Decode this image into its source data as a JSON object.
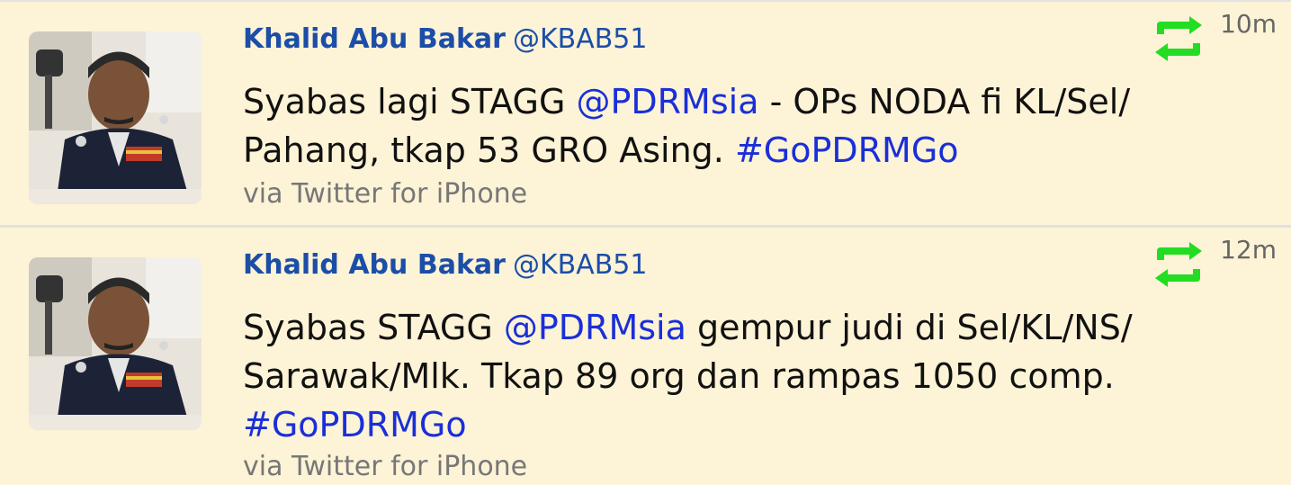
{
  "tweets": [
    {
      "name": "Khalid Abu Bakar",
      "handle": "@KBAB51",
      "time": "10m",
      "text_parts": [
        {
          "text": "Syabas lagi STAGG ",
          "kind": "plain"
        },
        {
          "text": "@PDRMsia",
          "kind": "mention"
        },
        {
          "text": " - OPs NODA fi KL/Sel/ Pahang, tkap 53 GRO Asing. ",
          "kind": "plain"
        },
        {
          "text": "#GoPDRMGo",
          "kind": "hashtag"
        }
      ],
      "via": "via Twitter for iPhone",
      "avatar_icon": "avatar-photo"
    },
    {
      "name": "Khalid Abu Bakar",
      "handle": "@KBAB51",
      "time": "12m",
      "text_parts": [
        {
          "text": "Syabas STAGG ",
          "kind": "plain"
        },
        {
          "text": "@PDRMsia",
          "kind": "mention"
        },
        {
          "text": " gempur judi di Sel/KL/NS/ Sarawak/Mlk. Tkap 89 org dan rampas 1050 comp. ",
          "kind": "plain"
        },
        {
          "text": "#GoPDRMGo",
          "kind": "hashtag"
        }
      ],
      "via": "via Twitter for iPhone",
      "avatar_icon": "avatar-photo"
    }
  ],
  "colors": {
    "background": "#fdf3d6",
    "name": "#1c4ea8",
    "link": "#1a2fd8",
    "retweet_icon": "#22dd22"
  },
  "icons": {
    "retweet": "retweet-icon"
  }
}
